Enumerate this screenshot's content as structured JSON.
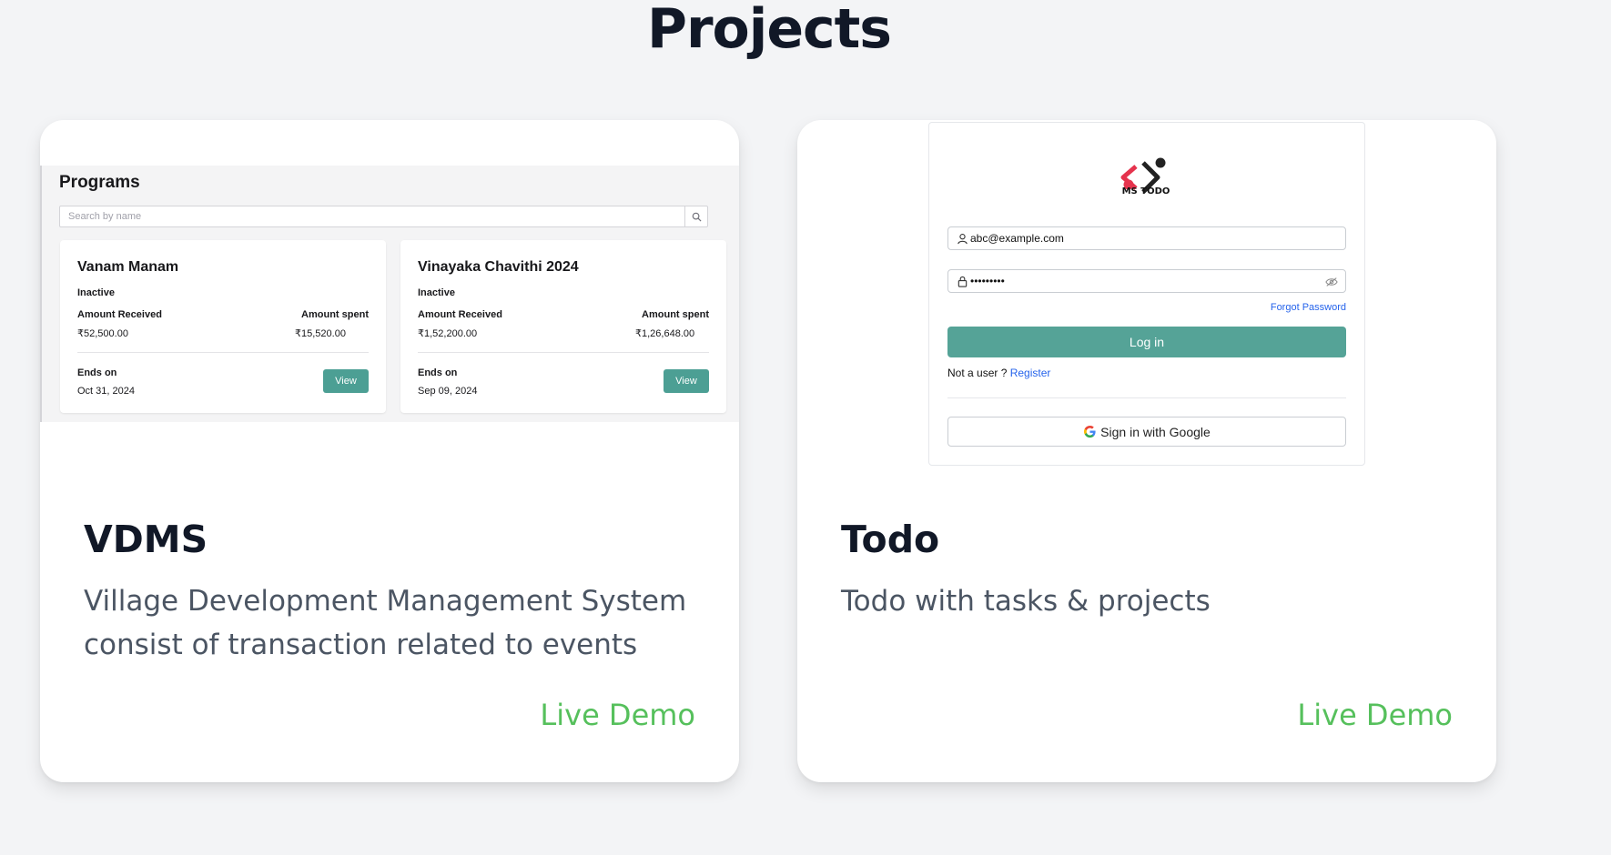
{
  "page": {
    "title": "Projects"
  },
  "projects": [
    {
      "title": "VDMS",
      "description": "Village Development Management System consist of transaction related to events",
      "link_label": "Live Demo",
      "preview": {
        "heading": "Programs",
        "search_placeholder": "Search by name",
        "programs": [
          {
            "name": "Vanam Manam",
            "status": "Inactive",
            "received_label": "Amount Received",
            "received": "₹52,500.00",
            "spent_label": "Amount spent",
            "spent": "₹15,520.00",
            "ends_label": "Ends on",
            "ends": "Oct 31, 2024",
            "button": "View"
          },
          {
            "name": "Vinayaka Chavithi 2024",
            "status": "Inactive",
            "received_label": "Amount Received",
            "received": "₹1,52,200.00",
            "spent_label": "Amount spent",
            "spent": "₹1,26,648.00",
            "ends_label": "Ends on",
            "ends": "Sep 09, 2024",
            "button": "View"
          }
        ]
      }
    },
    {
      "title": "Todo",
      "description": "Todo with tasks & projects",
      "link_label": "Live Demo",
      "preview": {
        "logo_text": "MS TODO",
        "email_value": "abc@example.com",
        "password_value": "•••••••••",
        "forgot_label": "Forgot Password",
        "login_label": "Log in",
        "not_user_label": "Not a user ?",
        "register_label": "Register",
        "google_label": "Sign in with Google"
      }
    }
  ],
  "colors": {
    "accent_green": "#56c05c",
    "teal_button": "#55a397",
    "link_blue": "#2563eb",
    "logo_red": "#e5334d"
  }
}
